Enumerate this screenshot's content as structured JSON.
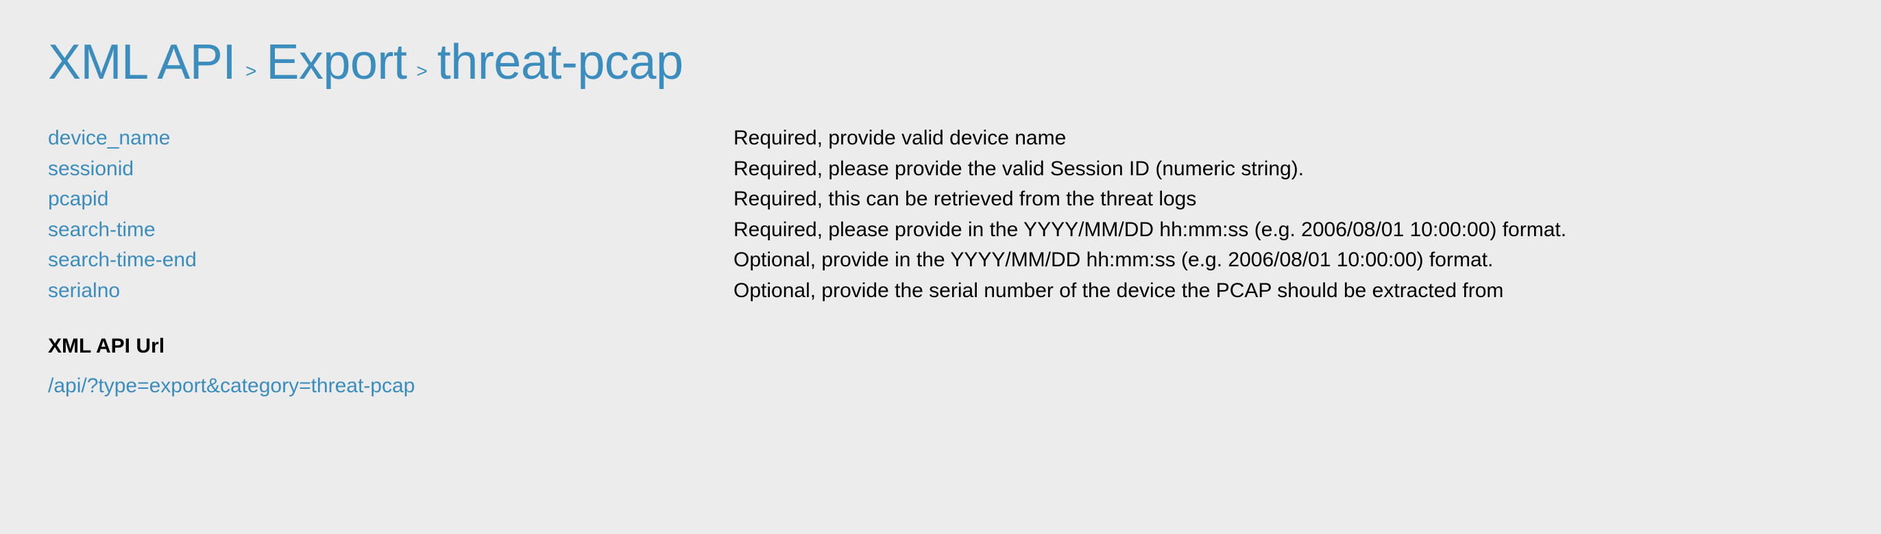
{
  "breadcrumb": {
    "part1": "XML API",
    "sep": ">",
    "part2": "Export",
    "part3": "threat-pcap"
  },
  "params": [
    {
      "name": "device_name",
      "desc": "Required, provide valid device name"
    },
    {
      "name": "sessionid",
      "desc": "Required, please provide the valid Session ID (numeric string)."
    },
    {
      "name": "pcapid",
      "desc": "Required, this can be retrieved from the threat logs"
    },
    {
      "name": "search-time",
      "desc": "Required, please provide in the YYYY/MM/DD hh:mm:ss (e.g. 2006/08/01 10:00:00) format."
    },
    {
      "name": "search-time-end",
      "desc": "Optional, provide in the YYYY/MM/DD hh:mm:ss (e.g. 2006/08/01 10:00:00) format."
    },
    {
      "name": "serialno",
      "desc": "Optional, provide the serial number of the device the PCAP should be extracted from"
    }
  ],
  "url_section": {
    "label": "XML API Url",
    "value": "/api/?type=export&category=threat-pcap"
  }
}
